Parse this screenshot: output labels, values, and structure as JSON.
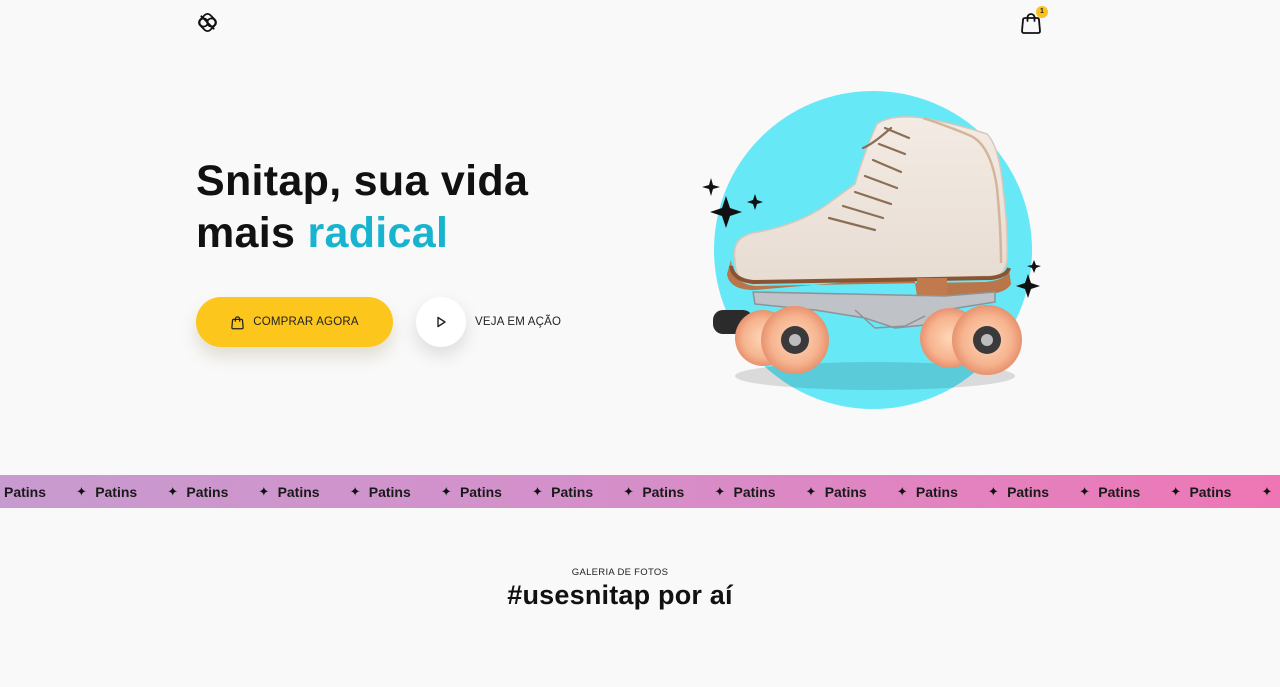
{
  "header": {
    "logo_icon": "snitap-logo-icon",
    "cart_icon": "shopping-bag-icon",
    "cart_count": "1"
  },
  "hero": {
    "title_line1": "Snitap, sua vida",
    "title_line2_start": "mais ",
    "title_highlight": "radical",
    "buy_button_label": "COMPRAR AGORA",
    "video_button_label": "VEJA EM AÇÃO"
  },
  "ticker": {
    "word": "Patins",
    "separator": "✦"
  },
  "gallery": {
    "eyebrow": "GALERIA DE FOTOS",
    "title": "#usesnitap por aí"
  },
  "colors": {
    "accent_cyan": "#18b4cf",
    "button_yellow": "#fcc61d",
    "ticker_start": "#c79bcf",
    "ticker_end": "#ef76b5",
    "circle_cyan": "#67e8f7"
  }
}
